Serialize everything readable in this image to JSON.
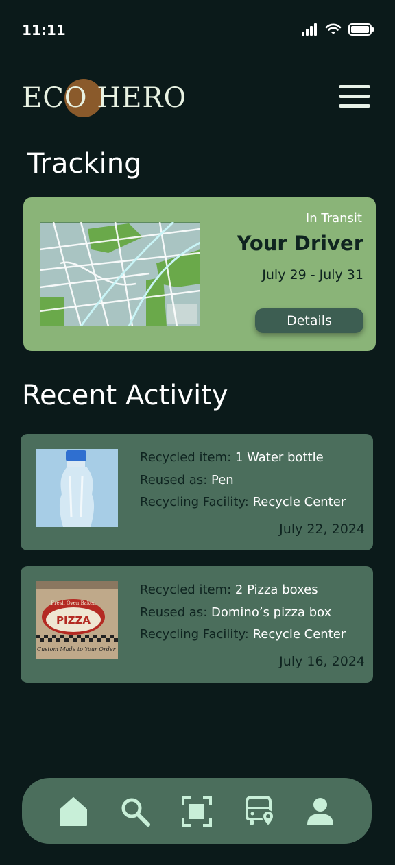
{
  "status_bar": {
    "time": "11:11"
  },
  "header": {
    "logo_text": "ECO HERO"
  },
  "tracking": {
    "title": "Tracking",
    "status": "In Transit",
    "driver": "Your Driver",
    "dates": "July 29 - July 31",
    "details_label": "Details"
  },
  "recent": {
    "title": "Recent Activity",
    "items": [
      {
        "item_key": "Recycled item:",
        "item_val": "1 Water bottle",
        "reused_key": "Reused as:",
        "reused_val": "Pen",
        "facility_key": "Recycling Facility:",
        "facility_val": "Recycle Center",
        "date": "July 22, 2024"
      },
      {
        "item_key": "Recycled item:",
        "item_val": "2 Pizza boxes",
        "reused_key": "Reused as:",
        "reused_val": "Domino’s pizza box",
        "facility_key": "Recycling Facility:",
        "facility_val": "Recycle Center",
        "date": "July 16, 2024"
      }
    ],
    "pizza_box_text": {
      "brand": "PIZZA",
      "top": "Fresh Oven Baked",
      "bottom": "Custom Made to Your Order"
    }
  },
  "nav": {
    "items": [
      {
        "icon": "home-icon"
      },
      {
        "icon": "search-icon"
      },
      {
        "icon": "scan-icon"
      },
      {
        "icon": "bus-location-icon"
      },
      {
        "icon": "profile-icon"
      }
    ]
  },
  "colors": {
    "background": "#0b1a1a",
    "tracking_card": "#8ab478",
    "activity_card": "#4b6e5c",
    "button": "#3d5e52",
    "logo_accent": "#8a5a2b"
  }
}
